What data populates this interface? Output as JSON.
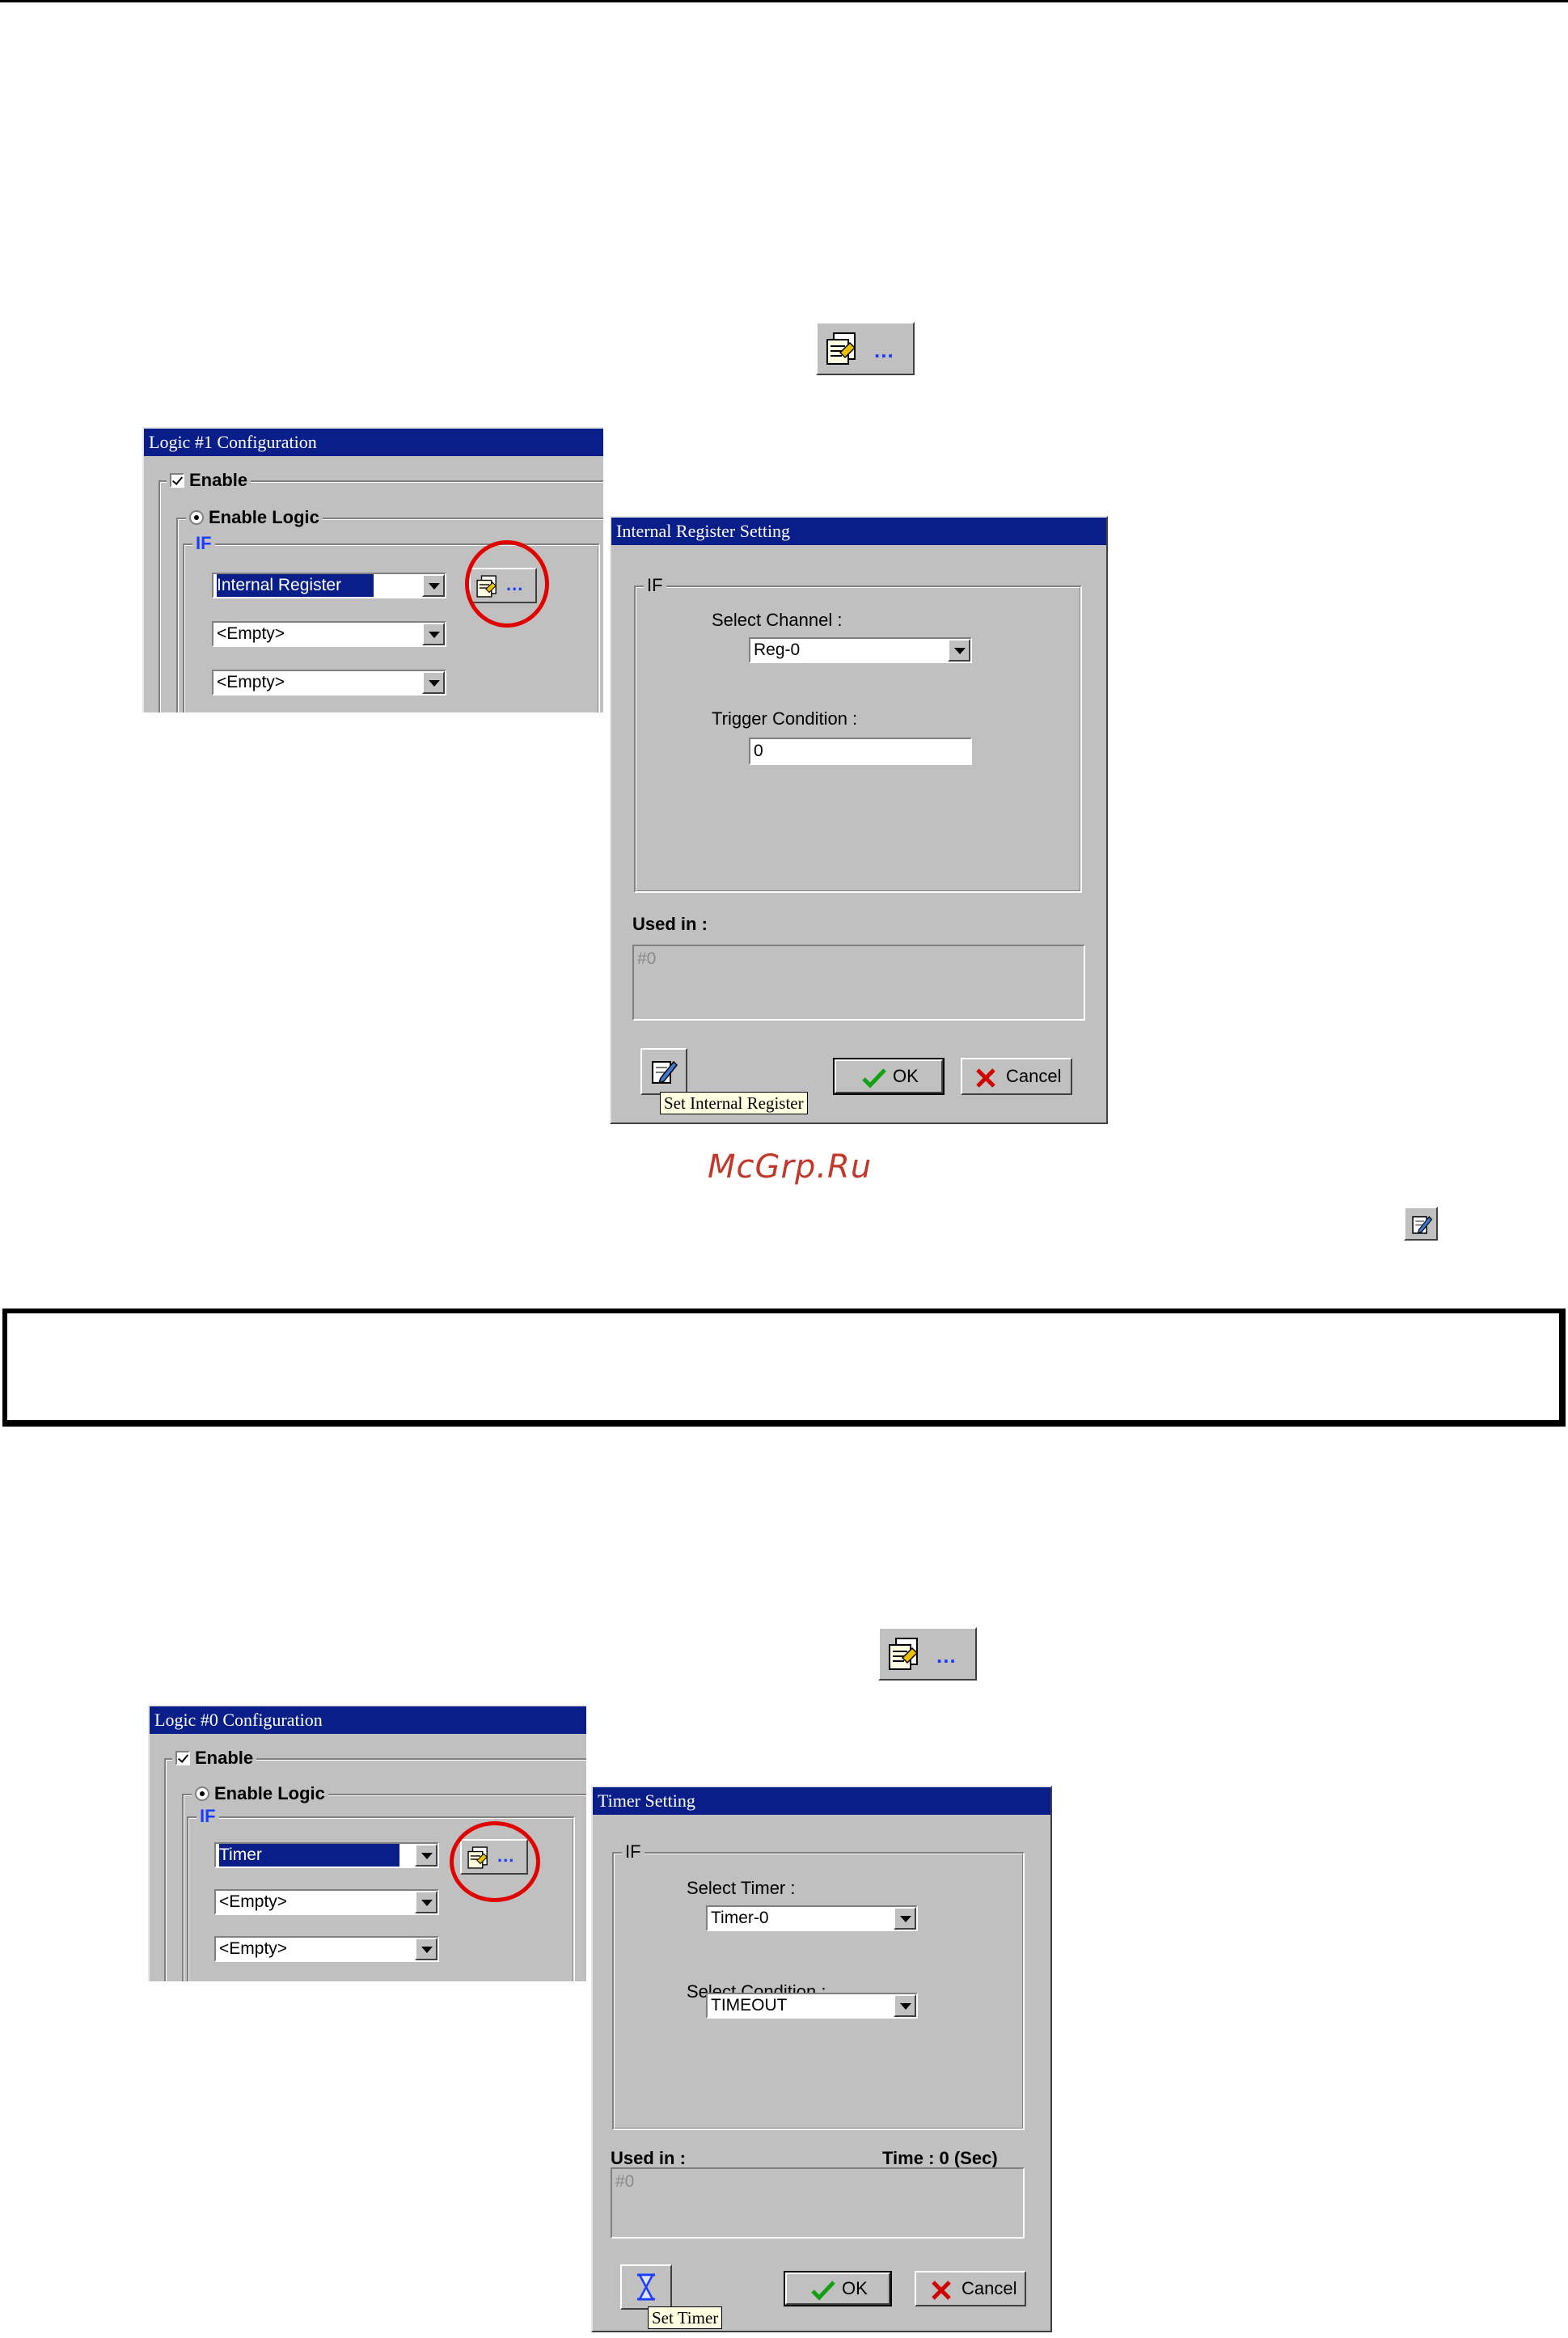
{
  "watermark": "McGrp.Ru",
  "dialog_a": {
    "title": "Logic #1 Configuration",
    "enable_label": "Enable",
    "enable_logic_label": "Enable Logic",
    "if_label": "IF",
    "combo_1": "Internal Register",
    "combo_2": "<Empty>",
    "combo_3": "<Empty>",
    "config_button_label": "..."
  },
  "dialog_b": {
    "title": "Internal Register Setting",
    "group_label": "IF",
    "select_channel_label": "Select Channel :",
    "select_channel_value": "Reg-0",
    "trigger_condition_label": "Trigger Condition :",
    "trigger_condition_value": "0",
    "used_in_label": "Used in :",
    "used_in_value": "#0",
    "ok_label": "OK",
    "cancel_label": "Cancel",
    "tooltip": "Set Internal Register"
  },
  "dialog_c": {
    "title": "Logic #0 Configuration",
    "enable_label": "Enable",
    "enable_logic_label": "Enable Logic",
    "if_label": "IF",
    "combo_1": "Timer",
    "combo_2": "<Empty>",
    "combo_3": "<Empty>",
    "config_button_label": "..."
  },
  "dialog_d": {
    "title": "Timer Setting",
    "group_label": "IF",
    "select_timer_label": "Select Timer :",
    "select_timer_value": "Timer-0",
    "select_condition_label": "Select Condition :",
    "select_condition_value": "TIMEOUT",
    "used_in_label": "Used in :",
    "time_label": "Time :  0  (Sec)",
    "used_in_value": "#0",
    "ok_label": "OK",
    "cancel_label": "Cancel",
    "tooltip": "Set Timer"
  },
  "standalone_button_label": "...",
  "icons": {
    "config": "config-document-icon",
    "edit": "edit-pencil-icon",
    "hourglass": "hourglass-icon",
    "check": "check-icon",
    "cross": "cross-icon"
  },
  "colors": {
    "title_bar": "#0a1e8a",
    "circle": "#e00000",
    "ellipsis": "#1a3cff",
    "watermark": "#c0392b"
  }
}
